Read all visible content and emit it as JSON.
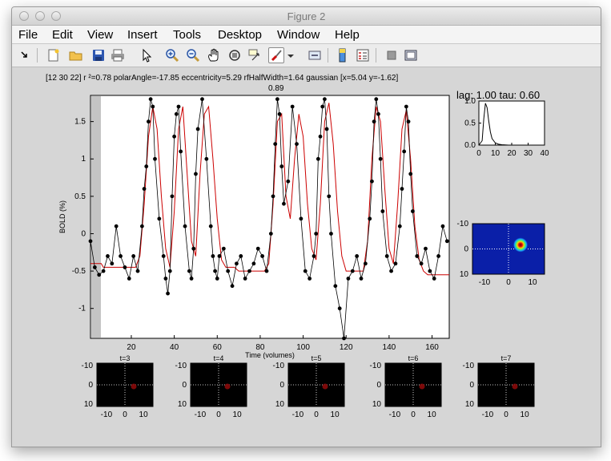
{
  "window": {
    "title": "Figure 2"
  },
  "menu": [
    "File",
    "Edit",
    "View",
    "Insert",
    "Tools",
    "Desktop",
    "Window",
    "Help"
  ],
  "toolbar_icons": [
    "pointer-arrow-icon",
    "new-figure-icon",
    "open-file-icon",
    "save-icon",
    "print-icon",
    "edit-plot-arrow-icon",
    "zoom-in-icon",
    "zoom-out-icon",
    "pan-hand-icon",
    "rotate-3d-icon",
    "data-cursor-icon",
    "brush-icon",
    "brush-dropdown-icon",
    "link-plot-icon",
    "insert-colorbar-icon",
    "insert-legend-icon",
    "hide-plot-tools-icon",
    "show-plot-tools-icon"
  ],
  "header": {
    "line1": "[12 30 22] r ²=0.78 polarAngle=-17.85 eccentricity=5.29 rfHalfWidth=1.64 gaussian [x=5.04 y=-1.62]",
    "line2": "0.89"
  },
  "lag_label": "lag: 1.00 tau: 0.60",
  "colors": {
    "data": "#000000",
    "fit": "#cc0000",
    "heatmap_bg": "#0a1fa8",
    "panel_bg": "#000000"
  },
  "chart_data": [
    {
      "type": "line",
      "xlabel": "Time (volumes)",
      "ylabel": "BOLD (%)",
      "xlim": [
        1,
        168
      ],
      "ylim": [
        -1.4,
        1.85
      ],
      "xticks": [
        20,
        40,
        60,
        80,
        100,
        120,
        140,
        160
      ],
      "yticks": [
        -1,
        -0.5,
        0,
        0.5,
        1,
        1.5
      ],
      "series": [
        {
          "style": "black-dots-line",
          "x": [
            1,
            3,
            5,
            7,
            9,
            11,
            13,
            15,
            17,
            19,
            21,
            23,
            25,
            26,
            27,
            28,
            29,
            30,
            31,
            33,
            35,
            36,
            37,
            38,
            39,
            40,
            41,
            42,
            43,
            45,
            47,
            48,
            49,
            50,
            51,
            53,
            55,
            57,
            58,
            59,
            60,
            61,
            63,
            65,
            67,
            69,
            71,
            73,
            75,
            77,
            79,
            81,
            83,
            85,
            86,
            87,
            88,
            89,
            90,
            91,
            93,
            95,
            97,
            99,
            101,
            103,
            105,
            106,
            107,
            108,
            109,
            110,
            111,
            112,
            113,
            115,
            117,
            119,
            121,
            123,
            125,
            127,
            129,
            131,
            132,
            133,
            134,
            135,
            136,
            137,
            139,
            141,
            143,
            145,
            146,
            147,
            148,
            149,
            150,
            151,
            153,
            155,
            157,
            159,
            161,
            163,
            165,
            167
          ],
          "y": [
            -0.1,
            -0.45,
            -0.55,
            -0.5,
            -0.3,
            -0.4,
            0.1,
            -0.3,
            -0.45,
            -0.6,
            -0.3,
            -0.5,
            0.1,
            0.6,
            0.9,
            1.5,
            1.8,
            1.7,
            1.0,
            0.2,
            -0.3,
            -0.6,
            -0.8,
            -0.5,
            0.5,
            1.3,
            1.6,
            1.7,
            1.1,
            0.1,
            -0.5,
            -0.6,
            -0.2,
            0.8,
            1.4,
            1.8,
            1.0,
            0.1,
            -0.3,
            -0.5,
            -0.6,
            -0.3,
            -0.2,
            -0.5,
            -0.7,
            -0.4,
            -0.3,
            -0.6,
            -0.5,
            -0.4,
            -0.2,
            -0.3,
            -0.5,
            0.0,
            0.5,
            1.2,
            1.8,
            1.6,
            0.9,
            0.4,
            0.7,
            1.7,
            1.2,
            0.2,
            -0.5,
            -0.6,
            -0.3,
            0.0,
            1.0,
            1.3,
            1.7,
            1.8,
            1.4,
            0.5,
            0.0,
            -0.7,
            -1.0,
            -1.4,
            -0.6,
            -0.5,
            -0.3,
            -0.6,
            -0.4,
            0.2,
            0.7,
            1.5,
            1.8,
            1.6,
            1.0,
            0.3,
            -0.3,
            -0.5,
            -0.4,
            0.1,
            0.6,
            1.1,
            1.7,
            1.5,
            0.8,
            0.3,
            -0.3,
            -0.4,
            -0.2,
            -0.5,
            -0.6,
            -0.3,
            0.1,
            -0.1
          ]
        },
        {
          "style": "red-fit-line",
          "x": [
            1,
            6,
            7,
            22,
            24,
            26,
            28,
            30,
            32,
            34,
            36,
            38,
            40,
            42,
            44,
            46,
            48,
            50,
            52,
            54,
            56,
            58,
            60,
            62,
            64,
            66,
            68,
            70,
            72,
            74,
            76,
            78,
            80,
            82,
            84,
            86,
            88,
            90,
            92,
            94,
            96,
            98,
            100,
            102,
            104,
            106,
            108,
            110,
            112,
            114,
            116,
            118,
            120,
            122,
            124,
            126,
            128,
            130,
            132,
            134,
            136,
            138,
            140,
            142,
            144,
            146,
            148,
            150,
            152,
            154,
            156,
            158,
            160,
            162,
            164,
            166,
            168
          ],
          "y": [
            -0.4,
            -0.4,
            -0.45,
            -0.45,
            -0.3,
            0.4,
            1.3,
            1.7,
            1.4,
            0.5,
            -0.2,
            -0.45,
            0.3,
            1.4,
            1.7,
            0.8,
            -0.1,
            -0.3,
            0.8,
            1.6,
            1.7,
            1.0,
            0.2,
            -0.35,
            -0.45,
            -0.45,
            -0.45,
            -0.5,
            -0.5,
            -0.5,
            -0.5,
            -0.5,
            -0.5,
            -0.5,
            -0.4,
            0.4,
            1.5,
            1.6,
            0.5,
            0.2,
            1.0,
            1.6,
            1.3,
            0.4,
            -0.2,
            -0.35,
            0.4,
            1.5,
            1.75,
            1.2,
            0.3,
            -0.3,
            -0.5,
            -0.5,
            -0.5,
            -0.5,
            -0.5,
            -0.1,
            1.0,
            1.7,
            1.5,
            0.6,
            -0.2,
            -0.4,
            0.4,
            1.4,
            1.65,
            1.0,
            0.1,
            -0.35,
            -0.5,
            -0.55,
            -0.55,
            -0.55,
            -0.55,
            -0.55,
            -0.55
          ]
        }
      ]
    },
    {
      "type": "line",
      "title": "lag: 1.00 tau: 0.60",
      "xlim": [
        0,
        40
      ],
      "ylim": [
        0,
        1
      ],
      "xticks": [
        0,
        10,
        20,
        30,
        40
      ],
      "yticks": [
        0.0,
        0.5,
        1.0
      ],
      "ytick_labels": [
        "0.0",
        "0.5",
        "1.0"
      ],
      "series": [
        {
          "style": "black-line",
          "x": [
            0,
            2,
            3,
            4,
            5,
            6,
            7,
            8,
            10,
            12,
            14,
            18,
            22,
            26
          ],
          "y": [
            0,
            0.1,
            0.6,
            0.95,
            0.85,
            0.55,
            0.3,
            0.15,
            0.05,
            0.02,
            0.01,
            0,
            0,
            0
          ]
        }
      ]
    },
    {
      "type": "heatmap",
      "description_role": "receptive-field",
      "xlim": [
        -15,
        15
      ],
      "ylim": [
        -10,
        10
      ],
      "xticks": [
        -10,
        0,
        10
      ],
      "yticks": [
        -10,
        0,
        10
      ],
      "peak": {
        "x": 5,
        "y": -1.6
      }
    }
  ],
  "frames": [
    {
      "label": "t=3"
    },
    {
      "label": "t=4"
    },
    {
      "label": "t=5"
    },
    {
      "label": "t=6"
    },
    {
      "label": "t=7"
    }
  ],
  "frame_axes": {
    "xticks": [
      "-10",
      "0",
      "10"
    ],
    "yticks": [
      "-10",
      "0",
      "10"
    ]
  }
}
